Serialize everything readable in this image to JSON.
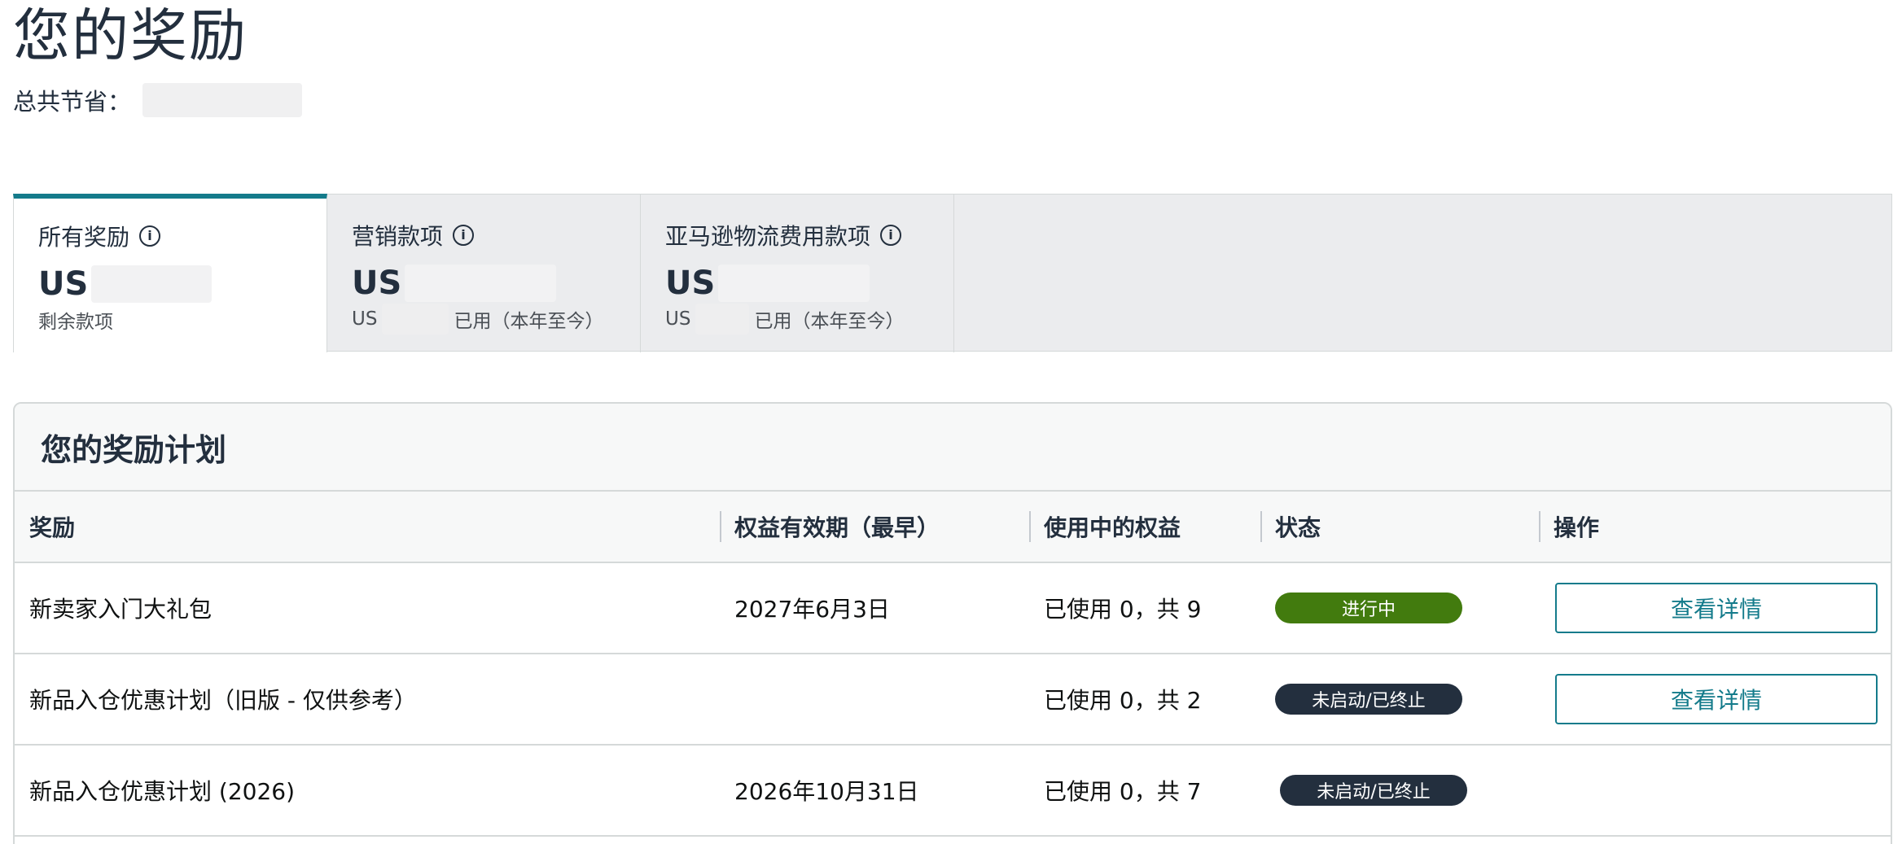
{
  "page": {
    "title": "您的奖励",
    "total_savings_label": "总共节省："
  },
  "tabs": [
    {
      "label": "所有奖励",
      "amount_prefix": "US",
      "sub_label": "剩余款项"
    },
    {
      "label": "营销款项",
      "amount_prefix": "US",
      "sub_prefix": "US",
      "sub_label": "已用（本年至今）"
    },
    {
      "label": "亚马逊物流费用款项",
      "amount_prefix": "US",
      "sub_prefix": "US",
      "sub_label": "已用（本年至今）"
    }
  ],
  "programs": {
    "title": "您的奖励计划",
    "columns": [
      "奖励",
      "权益有效期（最早）",
      "使用中的权益",
      "状态",
      "操作"
    ],
    "rows": [
      {
        "reward": "新卖家入门大礼包",
        "expiry": "2027年6月3日",
        "usage": "已使用 0，共 9",
        "status": "进行中",
        "status_type": "active",
        "action": "查看详情"
      },
      {
        "reward": "新品入仓优惠计划（旧版 - 仅供参考）",
        "expiry": "",
        "usage": "已使用 0，共 2",
        "status": "未启动/已终止",
        "status_type": "inactive",
        "action": "查看详情"
      },
      {
        "reward": "新品入仓优惠计划 (2026)",
        "expiry": "2026年10月31日",
        "usage": "已使用 0，共 7",
        "status": "未启动/已终止",
        "status_type": "inactive",
        "action": ""
      }
    ]
  },
  "colors": {
    "accent_teal": "#147b8b",
    "status_active": "#427b0e",
    "status_inactive": "#232f3e"
  }
}
